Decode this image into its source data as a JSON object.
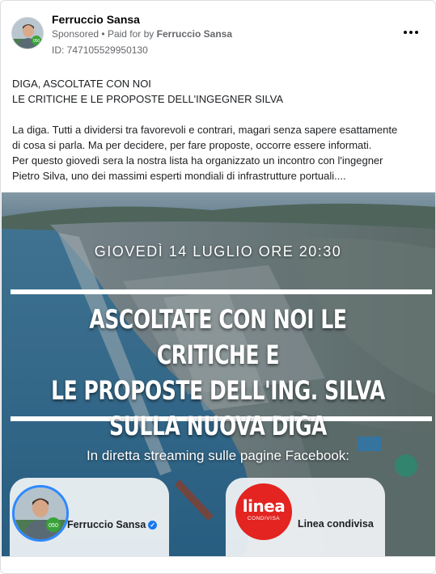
{
  "ad": {
    "advertiser": "Ferruccio Sansa",
    "sponsored": "Sponsored",
    "separator": "•",
    "paid_for_by_prefix": "Paid for by",
    "paid_for_by": "Ferruccio Sansa",
    "ad_id": "ID: 747105529950130",
    "more_icon": "more-horizontal-icon"
  },
  "post": {
    "lines": [
      "DIGA, ASCOLTATE CON NOI",
      "LE CRITICHE E LE PROPOSTE DELL'INGEGNER SILVA",
      "",
      "La diga. Tutti a dividersi tra favorevoli e contrari, magari senza sapere esattamente",
      "di cosa si parla. Ma per decidere, per fare proposte, occorre essere informati.",
      "Per questo giovedì sera la nostra lista ha organizzato un incontro con l'ingegner",
      "Pietro Silva, uno dei massimi esperti mondiali di infrastrutture portuali...."
    ]
  },
  "creative": {
    "datetime": "GIOVEDÌ 14 LUGLIO ORE 20:30",
    "headline_lines": [
      "ASCOLTATE CON NOI LE CRITICHE E",
      "LE PROPOSTE DELL'ING. SILVA",
      "SULLA NUOVA DIGA"
    ],
    "streaming": "In diretta streaming sulle pagine Facebook:",
    "page_left": "Ferruccio Sansa",
    "page_right": "Linea condivisa",
    "logo_word": "linea",
    "logo_sub": "CONDIVISA",
    "verified_icon": "verified-badge-icon"
  },
  "colors": {
    "accent_blue": "#1877f2",
    "logo_red": "#e32421",
    "sea": "#3f7ea3"
  }
}
